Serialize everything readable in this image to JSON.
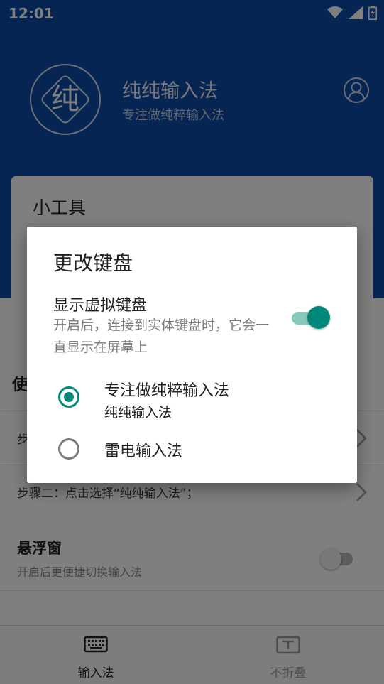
{
  "status_bar": {
    "time": "12:01"
  },
  "header": {
    "logo_char": "纯",
    "app_name": "纯纯输入法",
    "app_subtitle": "专注做纯粹输入法"
  },
  "tools": {
    "title": "小工具"
  },
  "usage": {
    "title_visible": "使",
    "steps": [
      {
        "label": "步"
      },
      {
        "label": "步骤二：点击选择“纯纯输入法”；"
      }
    ]
  },
  "float_window": {
    "title": "悬浮窗",
    "description": "开启后更便捷切换输入法",
    "enabled": false
  },
  "bottom_nav": {
    "items": [
      {
        "label": "输入法",
        "active": true
      },
      {
        "label": "不折叠",
        "active": false
      }
    ]
  },
  "dialog": {
    "title": "更改键盘",
    "toggle": {
      "label": "显示虚拟键盘",
      "description": "开启后，连接到实体键盘时，它会一直显示在屏幕上",
      "enabled": true
    },
    "options": [
      {
        "label": "专注做纯粹输入法",
        "sublabel": "纯纯输入法",
        "selected": true
      },
      {
        "label": "雷电输入法",
        "selected": false
      }
    ]
  },
  "colors": {
    "header_blue": "#0f4aa6",
    "accent_teal": "#00897b"
  }
}
